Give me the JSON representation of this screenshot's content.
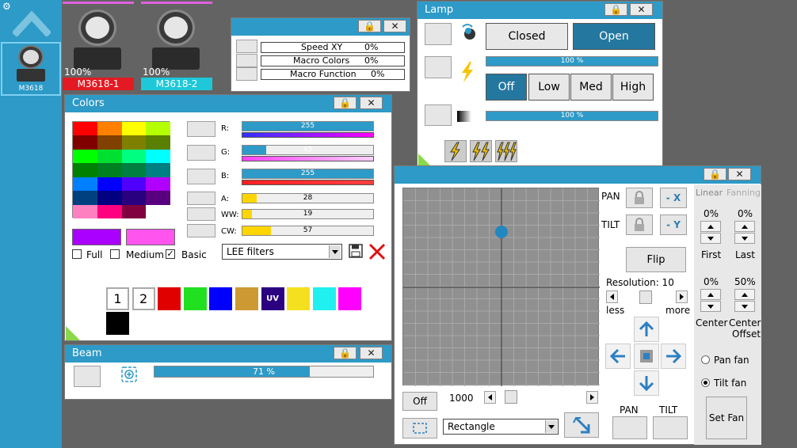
{
  "sidebar": {
    "fixture_label": "M3618"
  },
  "fixtures": [
    {
      "percent": "100%",
      "name": "M3618-1",
      "color": "#e31a23"
    },
    {
      "percent": "100%",
      "name": "M3618-2",
      "color": "#1ec8d8"
    }
  ],
  "macro": {
    "rows": [
      {
        "label": "Speed XY",
        "value": "0%"
      },
      {
        "label": "Macro Colors",
        "value": "0%"
      },
      {
        "label": "Macro Function",
        "value": "0%"
      }
    ]
  },
  "lamp": {
    "title": "Lamp",
    "closed_label": "Closed",
    "open_label": "Open",
    "intensity_bar": "100 %",
    "intensity_level": 1.0,
    "modes": [
      "Off",
      "Low",
      "Med",
      "High"
    ],
    "dimmer_bar": "100 %",
    "dimmer_level": 1.0
  },
  "colors": {
    "title": "Colors",
    "grid": [
      [
        "#ff0000",
        "#ff8000",
        "#ffff00",
        "#b4ff00"
      ],
      [
        "#800000",
        "#804000",
        "#808000",
        "#5a8000"
      ],
      [
        "#00ff00",
        "#00e030",
        "#00ff80",
        "#00ffff"
      ],
      [
        "#008000",
        "#008020",
        "#008040",
        "#008080"
      ],
      [
        "#0080ff",
        "#0000ff",
        "#5000ff",
        "#b000ff"
      ],
      [
        "#004080",
        "#000080",
        "#280080",
        "#580080"
      ],
      [
        "#ff80c0",
        "#ff0080",
        "#800040",
        "#ffffff"
      ]
    ],
    "preview_a": "#aa00ff",
    "preview_b": "#ff55ee",
    "channels": [
      {
        "label": "R:",
        "value": "255",
        "level": 1.0,
        "fill": "#2d9ac7",
        "grad": "linear-gradient(90deg,#3030ff,#ff00ff)"
      },
      {
        "label": "G:",
        "value": "45",
        "level": 0.18,
        "fill": "#2d9ac7",
        "grad": "linear-gradient(90deg,#ff40ff,#ffd0ff)"
      },
      {
        "label": "B:",
        "value": "255",
        "level": 1.0,
        "fill": "#2d9ac7",
        "grad": "linear-gradient(90deg,#ff2020,#ff4040)"
      },
      {
        "label": "A:",
        "value": "28",
        "level": 0.11,
        "fill": "#ffd500",
        "grad": ""
      },
      {
        "label": "WW:",
        "value": "19",
        "level": 0.07,
        "fill": "#ffd500",
        "grad": ""
      },
      {
        "label": "CW:",
        "value": "57",
        "level": 0.22,
        "fill": "#ffd500",
        "grad": ""
      }
    ],
    "options": [
      {
        "label": "Full",
        "checked": false
      },
      {
        "label": "Medium",
        "checked": false
      },
      {
        "label": "Basic",
        "checked": true
      }
    ],
    "filter_select": "LEE filters",
    "presets": [
      {
        "label": "1",
        "color": "#ffffff"
      },
      {
        "label": "2",
        "color": "#ffffff"
      },
      {
        "label": "",
        "color": "#e00000"
      },
      {
        "label": "",
        "color": "#20e020"
      },
      {
        "label": "",
        "color": "#0000ff"
      },
      {
        "label": "",
        "color": "#cc9933"
      },
      {
        "label": "UV",
        "color": "#2a0080"
      },
      {
        "label": "",
        "color": "#f5e020"
      },
      {
        "label": "",
        "color": "#20f0f0"
      },
      {
        "label": "",
        "color": "#ff00ff"
      },
      {
        "label": "",
        "color": "#000000"
      }
    ]
  },
  "beam": {
    "title": "Beam",
    "bar": "71 %",
    "level": 0.71
  },
  "pantilt": {
    "pan_label": "PAN",
    "tilt_label": "TILT",
    "minus_x": "- X",
    "minus_y": "- Y",
    "flip": "Flip",
    "resolution": "Resolution: 10",
    "less": "less",
    "more": "more",
    "off": "Off",
    "speed": "1000",
    "shape": "Rectangle",
    "bottom_pan": "PAN",
    "bottom_tilt": "TILT",
    "dot_x": 0.5,
    "dot_y": 0.22
  },
  "fanning": {
    "linear": "Linear",
    "fanning": "Fanning",
    "first_val": "0%",
    "last_val": "0%",
    "first": "First",
    "last": "Last",
    "center_val": "0%",
    "offset_val": "50%",
    "center": "Center",
    "center_offset_a": "Center",
    "center_offset_b": "Offset",
    "pan_fan": "Pan fan",
    "tilt_fan": "Tilt fan",
    "set_fan": "Set Fan"
  }
}
